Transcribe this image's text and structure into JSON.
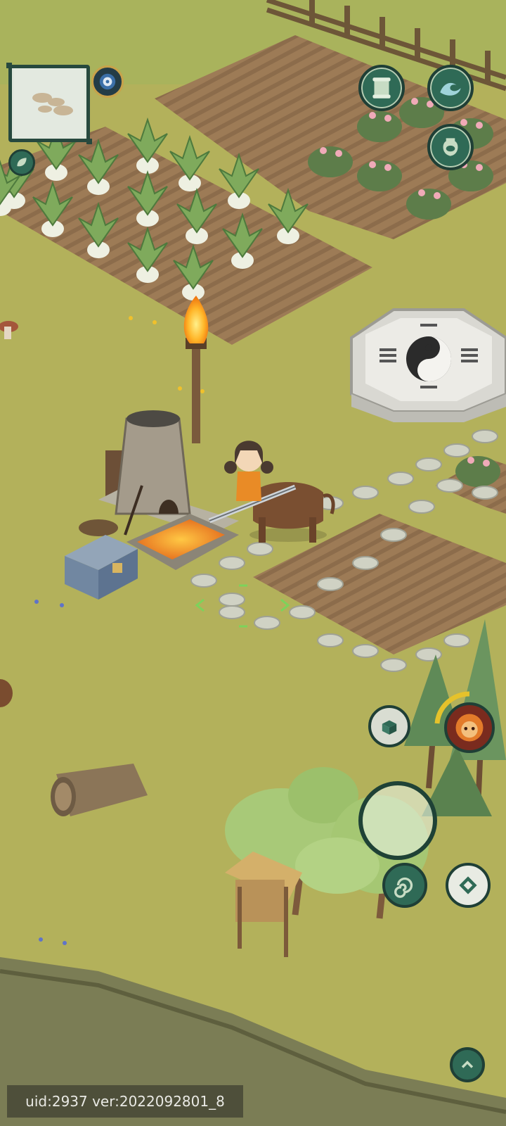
{
  "status_bar": {
    "text": "uid:2937 ver:2022092801_8"
  },
  "hud": {
    "top_right_buttons": [
      "scroll-icon",
      "wave-icon",
      "jar-icon"
    ],
    "side_buttons": [
      "leaf-icon",
      "compass-icon"
    ],
    "bottom_right_buttons": [
      "box-icon",
      "spiral-icon",
      "diamond-icon",
      "chevron-up-icon"
    ],
    "skill": "fire-face-icon"
  },
  "colors": {
    "ground": "#b4b35e",
    "soil": "#9c7b54",
    "hud_dark": "#2f6a56",
    "hud_border": "#1f3f36"
  }
}
